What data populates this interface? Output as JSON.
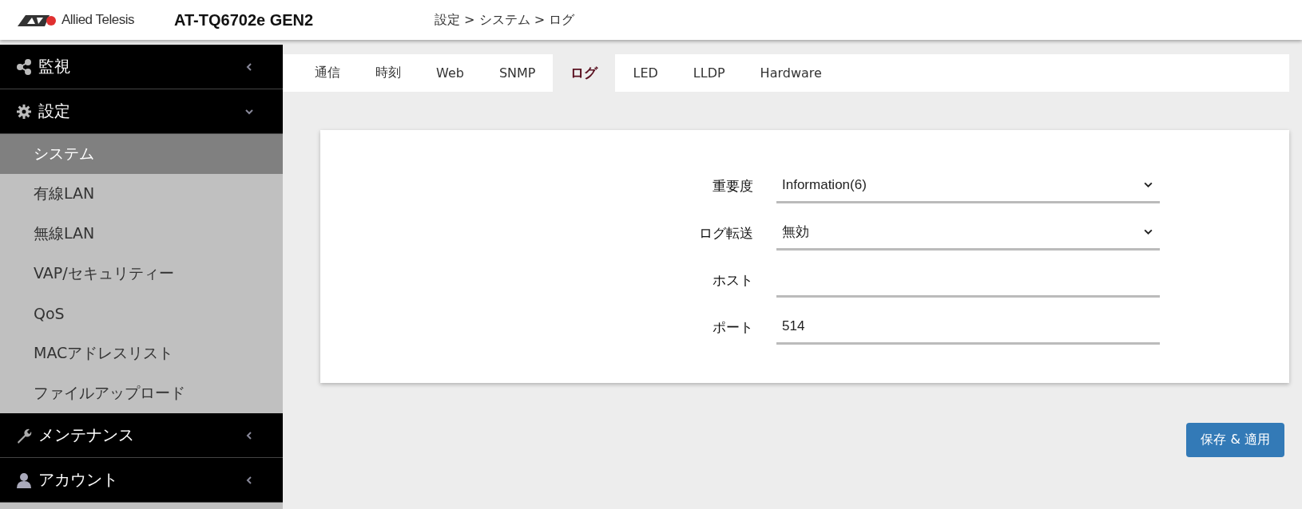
{
  "header": {
    "logo_text": "Allied Telesis",
    "model": "AT-TQ6702e GEN2",
    "breadcrumb": "設定 > システム > ログ"
  },
  "sidebar": {
    "sections": [
      {
        "label": "監視",
        "expanded": false
      },
      {
        "label": "設定",
        "expanded": true,
        "children": [
          {
            "label": "システム",
            "selected": true
          },
          {
            "label": "有線LAN",
            "selected": false
          },
          {
            "label": "無線LAN",
            "selected": false
          },
          {
            "label": "VAP/セキュリティー",
            "selected": false
          },
          {
            "label": "QoS",
            "selected": false
          },
          {
            "label": "MACアドレスリスト",
            "selected": false
          },
          {
            "label": "ファイルアップロード",
            "selected": false
          }
        ]
      },
      {
        "label": "メンテナンス",
        "expanded": false
      },
      {
        "label": "アカウント",
        "expanded": false
      }
    ]
  },
  "tabs": [
    {
      "label": "通信",
      "selected": false
    },
    {
      "label": "時刻",
      "selected": false
    },
    {
      "label": "Web",
      "selected": false
    },
    {
      "label": "SNMP",
      "selected": false
    },
    {
      "label": "ログ",
      "selected": true
    },
    {
      "label": "LED",
      "selected": false
    },
    {
      "label": "LLDP",
      "selected": false
    },
    {
      "label": "Hardware",
      "selected": false
    }
  ],
  "form": {
    "fields": [
      {
        "label": "重要度",
        "kind": "select",
        "value": "Information(6)"
      },
      {
        "label": "ログ転送",
        "kind": "select",
        "value": "無効"
      },
      {
        "label": "ホスト",
        "kind": "text"
      },
      {
        "label": "ポート",
        "kind": "text",
        "value": "514"
      }
    ]
  },
  "save_button": "保存 & 適用"
}
